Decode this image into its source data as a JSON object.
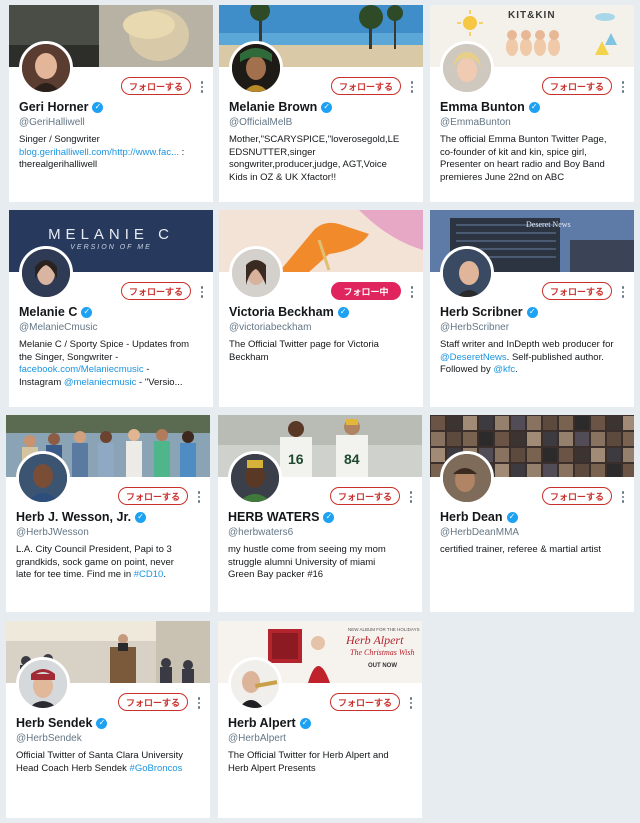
{
  "follow_label": "フォローする",
  "following_label": "フォロー中",
  "cards": [
    {
      "name": "Geri Horner",
      "handle": "@GeriHalliwell",
      "bio_lines": [
        {
          "parts": [
            {
              "t": "Singer / Songwriter"
            }
          ]
        },
        {
          "parts": [
            {
              "t": "blog.gerihalliwell.com/http://www.fac...",
              "link": true
            },
            {
              "t": " :"
            }
          ]
        },
        {
          "parts": [
            {
              "t": "therealgerihalliwell"
            }
          ]
        }
      ]
    },
    {
      "name": "Melanie Brown",
      "handle": "@OfficialMelB",
      "bio_lines": [
        {
          "parts": [
            {
              "t": "Mother,\"SCARYSPICE,\"loverosegold,LE"
            }
          ]
        },
        {
          "parts": [
            {
              "t": "EDSNUTTER,singer"
            }
          ]
        },
        {
          "parts": [
            {
              "t": "songwriter,producer,judge, AGT,Voice"
            }
          ]
        },
        {
          "parts": [
            {
              "t": "Kids in OZ & UK Xfactor!!"
            }
          ]
        }
      ]
    },
    {
      "name": "Emma Bunton",
      "handle": "@EmmaBunton",
      "banner_text": "KIT&KIN",
      "bio_lines": [
        {
          "parts": [
            {
              "t": "The official Emma Bunton Twitter Page,"
            }
          ]
        },
        {
          "parts": [
            {
              "t": "co-founder of kit and kin, spice girl,"
            }
          ]
        },
        {
          "parts": [
            {
              "t": "Presenter on heart radio and Boy Band"
            }
          ]
        },
        {
          "parts": [
            {
              "t": "premieres June 22nd on ABC"
            }
          ]
        }
      ]
    },
    {
      "name": "Melanie C",
      "handle": "@MelanieCmusic",
      "banner_title": "MELANIE C",
      "banner_subtitle": "VERSION OF ME",
      "bio_lines": [
        {
          "parts": [
            {
              "t": "Melanie C / Sporty Spice - Updates from"
            }
          ]
        },
        {
          "parts": [
            {
              "t": "the Singer, Songwriter -"
            }
          ]
        },
        {
          "parts": [
            {
              "t": "facebook.com/Melaniecmusic",
              "link": true
            },
            {
              "t": " -"
            }
          ]
        },
        {
          "parts": [
            {
              "t": "Instagram "
            },
            {
              "t": "@melaniecmusic",
              "link": true
            },
            {
              "t": " - \"Versio..."
            }
          ]
        }
      ]
    },
    {
      "name": "Victoria Beckham",
      "handle": "@victoriabeckham",
      "following": true,
      "bio_lines": [
        {
          "parts": [
            {
              "t": "The Official Twitter page for Victoria"
            }
          ]
        },
        {
          "parts": [
            {
              "t": "Beckham"
            }
          ]
        }
      ]
    },
    {
      "name": "Herb Scribner",
      "handle": "@HerbScribner",
      "banner_text": "Deseret News",
      "bio_lines": [
        {
          "parts": [
            {
              "t": "Staff writer and InDepth web producer for"
            }
          ]
        },
        {
          "parts": [
            {
              "t": "@DeseretNews",
              "link": true
            },
            {
              "t": ". Self-published author."
            }
          ]
        },
        {
          "parts": [
            {
              "t": "Followed by "
            },
            {
              "t": "@kfc",
              "link": true
            },
            {
              "t": "."
            }
          ]
        }
      ]
    },
    {
      "name": "Herb J. Wesson, Jr.",
      "handle": "@HerbJWesson",
      "bio_lines": [
        {
          "parts": [
            {
              "t": "L.A. City Council President, Papi to 3"
            }
          ]
        },
        {
          "parts": [
            {
              "t": "grandkids, sock game on point, never"
            }
          ]
        },
        {
          "parts": [
            {
              "t": "late for tee time. Find me in "
            },
            {
              "t": "#CD10",
              "link": true
            },
            {
              "t": "."
            }
          ]
        }
      ]
    },
    {
      "name": "HERB WATERS",
      "handle": "@herbwaters6",
      "jersey_left": "16",
      "jersey_right": "84",
      "bio_lines": [
        {
          "parts": [
            {
              "t": "my hustle come from seeing my mom"
            }
          ]
        },
        {
          "parts": [
            {
              "t": "struggle alumni University of miami"
            }
          ]
        },
        {
          "parts": [
            {
              "t": "Green Bay packer #16"
            }
          ]
        }
      ]
    },
    {
      "name": "Herb Dean",
      "handle": "@HerbDeanMMA",
      "bio_lines": [
        {
          "parts": [
            {
              "t": "certified trainer, referee & martial artist"
            }
          ]
        }
      ]
    },
    {
      "name": "Herb Sendek",
      "handle": "@HerbSendek",
      "bio_lines": [
        {
          "parts": [
            {
              "t": "Official Twitter of Santa Clara University"
            }
          ]
        },
        {
          "parts": [
            {
              "t": "Head Coach Herb Sendek "
            },
            {
              "t": "#GoBroncos",
              "link": true
            }
          ]
        }
      ]
    },
    {
      "name": "Herb Alpert",
      "handle": "@HerbAlpert",
      "banner_small": "NEW ALBUM FOR THE HOLIDAYS",
      "banner_title": "Herb Alpert",
      "banner_subtitle": "The Christmas Wish",
      "banner_badge": "OUT NOW",
      "bio_lines": [
        {
          "parts": [
            {
              "t": "The Official Twitter for Herb Alpert and"
            }
          ]
        },
        {
          "parts": [
            {
              "t": "Herb Alpert Presents"
            }
          ]
        }
      ]
    }
  ],
  "colors": {
    "page_bg": "#e6ecf0",
    "follow_red": "#c9302c",
    "following_pink": "#e0245e",
    "verified_blue": "#1da1f2",
    "link_blue": "#1b95e0"
  },
  "icons": [
    "verified-badge-icon",
    "more-options-icon"
  ]
}
